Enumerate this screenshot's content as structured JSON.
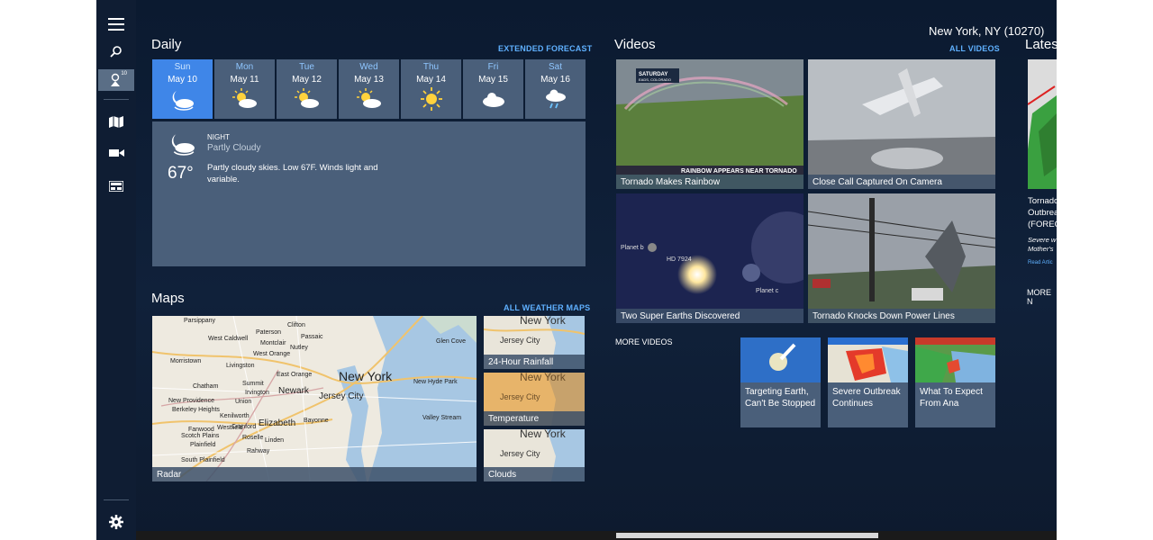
{
  "rail": {
    "location_badge": "10"
  },
  "location": "New York, NY (10270)",
  "daily": {
    "title": "Daily",
    "extended_link": "EXTENDED FORECAST",
    "days": [
      {
        "name": "Sun",
        "date": "May 10",
        "icon": "partly-cloudy-night-icon"
      },
      {
        "name": "Mon",
        "date": "May 11",
        "icon": "partly-sunny-icon"
      },
      {
        "name": "Tue",
        "date": "May 12",
        "icon": "partly-sunny-icon"
      },
      {
        "name": "Wed",
        "date": "May 13",
        "icon": "partly-sunny-icon"
      },
      {
        "name": "Thu",
        "date": "May 14",
        "icon": "sunny-icon"
      },
      {
        "name": "Fri",
        "date": "May 15",
        "icon": "cloudy-icon"
      },
      {
        "name": "Sat",
        "date": "May 16",
        "icon": "rain-icon"
      }
    ],
    "detail": {
      "period": "NIGHT",
      "condition": "Partly Cloudy",
      "temp": "67°",
      "summary": "Partly cloudy skies. Low 67F. Winds light and variable."
    }
  },
  "maps": {
    "title": "Maps",
    "all_link": "ALL WEATHER MAPS",
    "radar_caption": "Radar",
    "rainfall_caption": "24-Hour Rainfall",
    "temperature_caption": "Temperature",
    "clouds_caption": "Clouds",
    "map_labels": {
      "new_york": "New York",
      "jersey_city": "Jersey City",
      "newark": "Newark",
      "elizabeth": "Elizabeth",
      "parsippany": "Parsippany",
      "clifton": "Clifton",
      "paterson": "Paterson",
      "passaic": "Passaic",
      "nutley": "Nutley",
      "west_caldwell": "West Caldwell",
      "montclair": "Montclair",
      "livingston": "Livingston",
      "west_orange": "West Orange",
      "east_orange": "East Orange",
      "irvington": "Irvington",
      "bayonne": "Bayonne",
      "new_providence": "New Providence",
      "westfield": "Westfield",
      "scotch_plains": "Scotch Plains",
      "rahway": "Rahway",
      "south_plainfield": "South Plainfield",
      "linden": "Linden",
      "union": "Union",
      "kenilworth": "Kenilworth",
      "chatham": "Chatham",
      "morristown": "Morristown",
      "berkeley_heights": "Berkeley Heights",
      "summit": "Summit",
      "cranford": "Cranford",
      "plainfield": "Plainfield",
      "fanwood": "Fanwood",
      "roselle": "Roselle",
      "valley_stream": "Valley Stream",
      "glen_cove": "Glen Cove",
      "new_hyde_park": "New Hyde Park",
      "new_york_mini": "New York",
      "jersey_city_mini": "Jersey City"
    }
  },
  "videos": {
    "title": "Videos",
    "all_link": "ALL VIDEOS",
    "tiles": [
      {
        "caption": "Tornado Makes Rainbow",
        "overlay_top": "SATURDAY",
        "overlay_sub": "EADS, COLORADO",
        "banner": "RAINBOW APPEARS NEAR TORNADO"
      },
      {
        "caption": "Close Call Captured On Camera"
      },
      {
        "caption": "Two Super Earths Discovered",
        "label_b": "Planet b",
        "label_hd": "HD 7924",
        "label_c": "Planet c"
      },
      {
        "caption": "Tornado Knocks Down Power Lines"
      }
    ],
    "more_label": "MORE VIDEOS",
    "more": [
      {
        "caption": "Targeting Earth, Can't Be Stopped"
      },
      {
        "caption": "Severe Outbreak Continues"
      },
      {
        "caption": "What To Expect From Ana"
      }
    ]
  },
  "latest": {
    "title": "Latest",
    "article_title": "Tornado Outbrea (FOREC",
    "article_sub": "Severe w Mother's",
    "read_link": "Read Artic",
    "more_link": "MORE N"
  }
}
